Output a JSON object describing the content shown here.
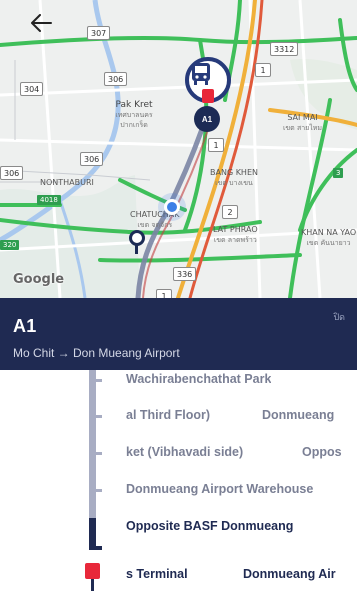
{
  "map": {
    "provider": "Google",
    "shields": [
      "307",
      "306",
      "3312",
      "1",
      "304",
      "306",
      "1",
      "306",
      "2",
      "336",
      "1"
    ],
    "labels": [
      {
        "main": "Pak Kret",
        "sub": "เทศบาลนคร ปากเกร็ด"
      },
      {
        "main": "SAI MAI",
        "sub": "เขต สายไหม"
      },
      {
        "main": "BANG KHEN",
        "sub": "เขต บางเขน"
      },
      {
        "main": "NONTHABURI",
        "sub": ""
      },
      {
        "main": "CHATUCHAK",
        "sub": "เขต จตุจักร"
      },
      {
        "main": "LAT PHRAO",
        "sub": "เขต ลาดพร้าว"
      },
      {
        "main": "KHAN NA YAO",
        "sub": "เขต คันนายาว"
      }
    ],
    "tags": [
      "4018",
      "320",
      "3"
    ],
    "pin_label": "A1"
  },
  "header": {
    "route_code": "A1",
    "route_description": "Mo Chit → Don Mueang Airport",
    "badge": "ปิด"
  },
  "stops": [
    {
      "name": "Wachirabenchathat Park",
      "secondary": ""
    },
    {
      "name": "al Third Floor)",
      "secondary": "Donmueang"
    },
    {
      "name": "ket (Vibhavadi side)",
      "secondary": "Oppos"
    },
    {
      "name": "Donmueang Airport Warehouse",
      "secondary": ""
    },
    {
      "name": "Opposite BASF Donmueang",
      "secondary": "",
      "active": true
    },
    {
      "name": "s Terminal",
      "secondary": "Donmueang Air",
      "terminal": true
    }
  ]
}
